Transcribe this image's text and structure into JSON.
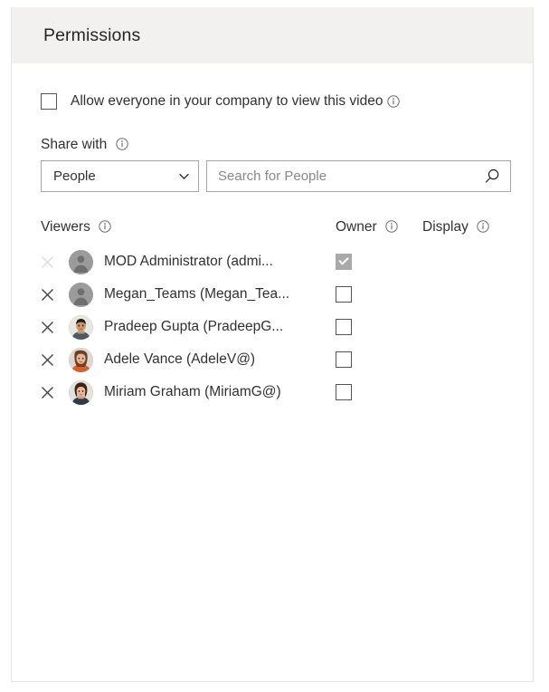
{
  "header": {
    "title": "Permissions"
  },
  "allow_everyone": {
    "label": "Allow everyone in your company to view this video",
    "checked": false,
    "info_icon": "info-icon"
  },
  "share_with": {
    "label": "Share with",
    "info_icon": "info-icon",
    "type_select": {
      "value": "People",
      "chevron_icon": "chevron-down-icon",
      "options": [
        "People"
      ]
    },
    "search": {
      "value": "",
      "placeholder": "Search for People",
      "icon": "search-icon"
    }
  },
  "table": {
    "columns": [
      {
        "key": "viewers",
        "label": "Viewers",
        "info_icon": "info-icon"
      },
      {
        "key": "owner",
        "label": "Owner",
        "info_icon": "info-icon"
      },
      {
        "key": "display",
        "label": "Display",
        "info_icon": "info-icon"
      }
    ],
    "rows": [
      {
        "name": "MOD Administrator (admi...",
        "avatar_type": "placeholder",
        "owner_checked": true,
        "owner_disabled": true,
        "remove_disabled": true,
        "remove_icon": "close-icon"
      },
      {
        "name": "Megan_Teams (Megan_Tea...",
        "avatar_type": "placeholder",
        "owner_checked": false,
        "owner_disabled": false,
        "remove_disabled": false,
        "remove_icon": "close-icon"
      },
      {
        "name": "Pradeep Gupta (PradeepG...",
        "avatar_type": "photo",
        "owner_checked": false,
        "owner_disabled": false,
        "remove_disabled": false,
        "remove_icon": "close-icon"
      },
      {
        "name": "Adele Vance (AdeleV@)",
        "avatar_type": "photo",
        "owner_checked": false,
        "owner_disabled": false,
        "remove_disabled": false,
        "remove_icon": "close-icon"
      },
      {
        "name": "Miriam Graham (MiriamG@)",
        "avatar_type": "photo",
        "owner_checked": false,
        "owner_disabled": false,
        "remove_disabled": false,
        "remove_icon": "close-icon"
      }
    ]
  },
  "colors": {
    "header_bg": "#f2f1f0",
    "text": "#323130",
    "title": "#262626",
    "border": "#a8a6a4",
    "card_border": "#e6e4e2",
    "checkbox_border": "#555453",
    "checked_disabled_bg": "#a9a9a9",
    "avatar_placeholder_bg": "#9b9b9b",
    "icon_gray": "#6e6e6e",
    "icon_gray_disabled": "#d6d4d2"
  }
}
